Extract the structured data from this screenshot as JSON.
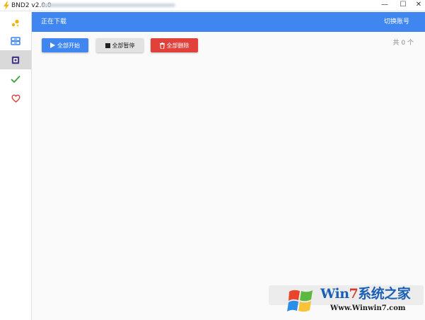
{
  "window": {
    "title": "BND2 v2.0.0",
    "controls": {
      "minimize": "—",
      "maximize": "☐",
      "close": "✕"
    }
  },
  "sidebar": {
    "items": [
      {
        "name": "logo",
        "icon": "dots-logo-icon",
        "active": false
      },
      {
        "name": "downloading",
        "icon": "inbox-tray-icon",
        "active": false
      },
      {
        "name": "box",
        "icon": "package-box-icon",
        "active": true
      },
      {
        "name": "completed",
        "icon": "checkmark-icon",
        "active": false
      },
      {
        "name": "favorites",
        "icon": "heart-icon",
        "active": false
      }
    ]
  },
  "header": {
    "title": "正在下载",
    "switch_account": "切换账号"
  },
  "toolbar": {
    "start_all": "全部开始",
    "pause_all": "全部暂停",
    "delete_all": "全部删除"
  },
  "summary": {
    "count_text": "共 0 个"
  },
  "watermark": {
    "brand_prefix": "Win",
    "brand_seven": "7",
    "brand_suffix": "系统之家",
    "url": "Www.Winwin7.com"
  },
  "colors": {
    "accent": "#3f86f0",
    "danger": "#e0413a",
    "neutral_button": "#e2e2e2",
    "check": "#3aa33a",
    "heart": "#e0413a"
  }
}
